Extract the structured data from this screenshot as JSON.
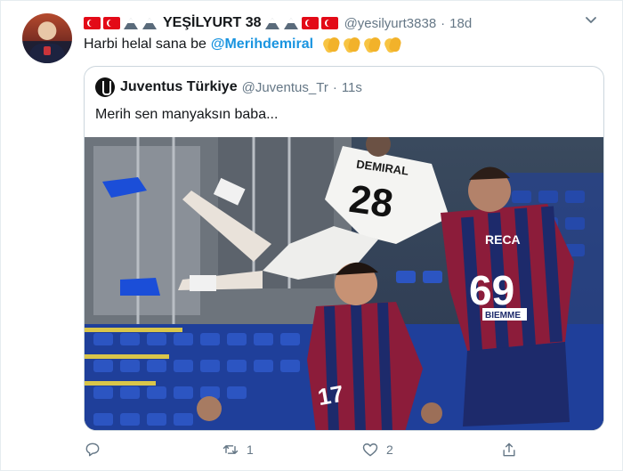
{
  "tweet": {
    "display_name": "YEŞİLYURT 38",
    "handle": "@yesilyurt3838",
    "separator": "·",
    "time": "18d",
    "text": "Harbi helal sana be",
    "mention": "@Merihdemiral",
    "name_decorations": [
      "turkish-flag-icon",
      "turkish-flag-icon",
      "mountain-icon",
      "mountain-icon"
    ],
    "trailing_emoji": [
      "clapping-hands-icon",
      "clapping-hands-icon",
      "clapping-hands-icon",
      "clapping-hands-icon"
    ]
  },
  "quoted": {
    "display_name": "Juventus Türkiye",
    "handle": "@Juventus_Tr",
    "separator": "·",
    "time": "11s",
    "text": "Merih sen manyaksın baba...",
    "image": {
      "jersey_white_name": "DEMIRAL",
      "jersey_white_number": "28",
      "jersey_red_name": "RECA",
      "jersey_red_number": "69",
      "jersey_red_sponsor": "BIEMME",
      "jersey_front_player_partial": "17"
    }
  },
  "actions": {
    "reply_count": "",
    "retweet_count": "1",
    "like_count": "2"
  },
  "colors": {
    "accent": "#1b95e0",
    "secondary_text": "#657786",
    "border": "#ccd6dd"
  }
}
